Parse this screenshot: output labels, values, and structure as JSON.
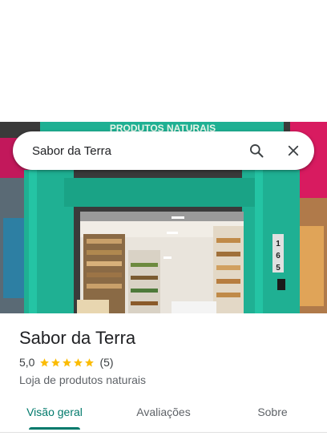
{
  "search": {
    "query": "Sabor da Terra",
    "search_icon": "search-icon",
    "close_icon": "close-icon"
  },
  "photo": {
    "sign_text": "PRODUTOS NATURAIS",
    "door_number": "165"
  },
  "place": {
    "name": "Sabor da Terra",
    "rating": "5,0",
    "stars": 5,
    "reviews": "(5)",
    "category": "Loja de produtos naturais"
  },
  "tabs": [
    {
      "label": "Visão geral",
      "active": true
    },
    {
      "label": "Avaliações",
      "active": false
    },
    {
      "label": "Sobre",
      "active": false
    }
  ],
  "colors": {
    "accent": "#00796b",
    "star": "#fbbc04",
    "storefront": "#1fb093"
  }
}
